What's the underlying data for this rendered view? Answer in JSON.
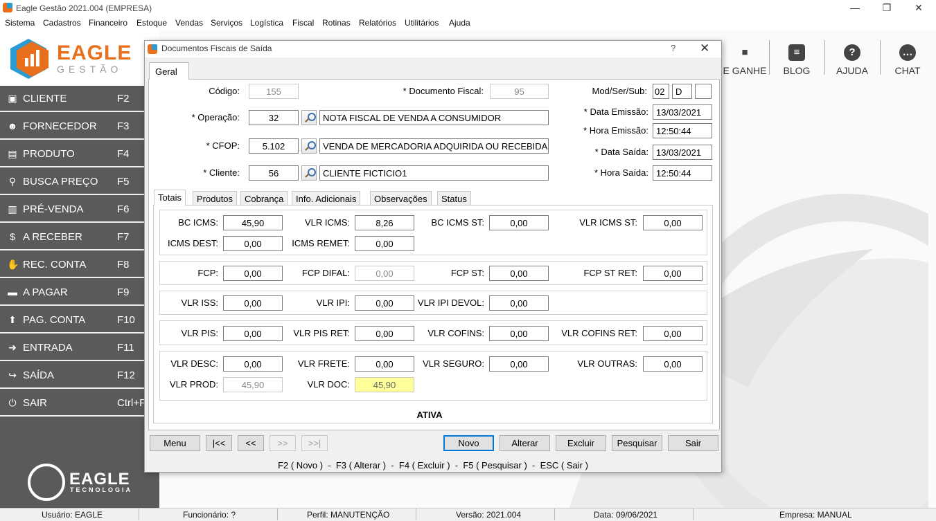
{
  "app": {
    "title": "Eagle Gestão 2021.004 (EMPRESA)",
    "window_buttons": {
      "minimize": "—",
      "restore": "❐",
      "close": "✕"
    }
  },
  "menu": [
    "Sistema",
    "Cadastros",
    "Financeiro",
    "Estoque",
    "Vendas",
    "Serviços",
    "Logística",
    "Fiscal",
    "Rotinas",
    "Relatórios",
    "Utilitários",
    "Ajuda"
  ],
  "logo": {
    "word": "EAGLE",
    "sub": "GESTÃO",
    "footer_word": "EAGLE",
    "footer_sub": "TECNOLOGIA"
  },
  "sidebar": [
    {
      "icon": "id-card-icon",
      "glyph": "▣",
      "label": "CLIENTE",
      "key": "F2"
    },
    {
      "icon": "users-icon",
      "glyph": "👥",
      "label": "FORNECEDOR",
      "key": "F3"
    },
    {
      "icon": "box-icon",
      "glyph": "▤",
      "label": "PRODUTO",
      "key": "F4"
    },
    {
      "icon": "search-icon",
      "glyph": "🔍",
      "label": "BUSCA PREÇO",
      "key": "F5"
    },
    {
      "icon": "basket-icon",
      "glyph": "🧺",
      "label": "PRÉ-VENDA",
      "key": "F6"
    },
    {
      "icon": "dollar-icon",
      "glyph": "$",
      "label": "A RECEBER",
      "key": "F7"
    },
    {
      "icon": "hand-money-icon",
      "glyph": "✋",
      "label": "REC. CONTA",
      "key": "F8"
    },
    {
      "icon": "wallet-icon",
      "glyph": "▬",
      "label": "A PAGAR",
      "key": "F9"
    },
    {
      "icon": "upload-icon",
      "glyph": "⬆",
      "label": "PAG. CONTA",
      "key": "F10"
    },
    {
      "icon": "sign-in-icon",
      "glyph": "➜",
      "label": "ENTRADA",
      "key": "F11"
    },
    {
      "icon": "sign-out-icon",
      "glyph": "↪",
      "label": "SAÍDA",
      "key": "F12"
    },
    {
      "icon": "power-icon",
      "glyph": "⏻",
      "label": "SAIR",
      "key": "Ctrl+F"
    }
  ],
  "topbar": [
    {
      "icon": "gift-icon",
      "glyph": "🎁",
      "label": "E GANHE"
    },
    {
      "icon": "blog-icon",
      "glyph": "≡",
      "label": "BLOG"
    },
    {
      "icon": "help-icon",
      "glyph": "?",
      "label": "AJUDA"
    },
    {
      "icon": "chat-icon",
      "glyph": "💬",
      "label": "CHAT"
    }
  ],
  "statusbar": {
    "usuario": "Usuário: EAGLE",
    "funcionario": "Funcionário: ?",
    "perfil": "Perfil: MANUTENÇÃO",
    "versao": "Versão: 2021.004",
    "data": "Data: 09/06/2021",
    "empresa": "Empresa: MANUAL"
  },
  "dialog": {
    "title": "Documentos Fiscais de Saída",
    "help": "?",
    "close": "✕",
    "tab": "Geral",
    "codigo_label": "Código:",
    "codigo": "155",
    "doc_fiscal_label": "* Documento Fiscal:",
    "doc_fiscal": "95",
    "modsersub_label": "Mod/Ser/Sub:",
    "mod": "02",
    "ser": "D",
    "sub": "",
    "operacao_label": "* Operação:",
    "operacao_code": "32",
    "operacao_desc": "NOTA FISCAL DE VENDA A CONSUMIDOR",
    "cfop_label": "* CFOP:",
    "cfop_code": "5.102",
    "cfop_desc": "VENDA DE MERCADORIA ADQUIRIDA OU RECEBIDA",
    "cliente_label": "* Cliente:",
    "cliente_code": "56",
    "cliente_desc": "CLIENTE FICTICIO1",
    "data_emissao_label": "* Data Emissão:",
    "data_emissao": "13/03/2021",
    "hora_emissao_label": "* Hora Emissão:",
    "hora_emissao": "12:50:44",
    "data_saida_label": "* Data Saída:",
    "data_saida": "13/03/2021",
    "hora_saida_label": "* Hora Saída:",
    "hora_saida": "12:50:44",
    "subtabs": [
      "Totais",
      "Produtos",
      "Cobrança",
      "Info. Adicionais",
      "Observações",
      "Status"
    ],
    "totais": {
      "bc_icms_label": "BC ICMS:",
      "bc_icms": "45,90",
      "vlr_icms_label": "VLR ICMS:",
      "vlr_icms": "8,26",
      "bc_icms_st_label": "BC ICMS ST:",
      "bc_icms_st": "0,00",
      "vlr_icms_st_label": "VLR ICMS ST:",
      "vlr_icms_st": "0,00",
      "icms_dest_label": "ICMS DEST:",
      "icms_dest": "0,00",
      "icms_remet_label": "ICMS REMET:",
      "icms_remet": "0,00",
      "fcp_label": "FCP:",
      "fcp": "0,00",
      "fcp_difal_label": "FCP DIFAL:",
      "fcp_difal": "0,00",
      "fcp_st_label": "FCP ST:",
      "fcp_st": "0,00",
      "fcp_st_ret_label": "FCP ST RET:",
      "fcp_st_ret": "0,00",
      "vlr_iss_label": "VLR ISS:",
      "vlr_iss": "0,00",
      "vlr_ipi_label": "VLR IPI:",
      "vlr_ipi": "0,00",
      "vlr_ipi_devol_label": "VLR IPI DEVOL:",
      "vlr_ipi_devol": "0,00",
      "vlr_pis_label": "VLR PIS:",
      "vlr_pis": "0,00",
      "vlr_pis_ret_label": "VLR PIS RET:",
      "vlr_pis_ret": "0,00",
      "vlr_cofins_label": "VLR COFINS:",
      "vlr_cofins": "0,00",
      "vlr_cofins_ret_label": "VLR COFINS RET:",
      "vlr_cofins_ret": "0,00",
      "vlr_desc_label": "VLR DESC:",
      "vlr_desc": "0,00",
      "vlr_frete_label": "VLR FRETE:",
      "vlr_frete": "0,00",
      "vlr_seguro_label": "VLR SEGURO:",
      "vlr_seguro": "0,00",
      "vlr_outras_label": "VLR OUTRAS:",
      "vlr_outras": "0,00",
      "vlr_prod_label": "VLR PROD:",
      "vlr_prod": "45,90",
      "vlr_doc_label": "VLR DOC:",
      "vlr_doc": "45,90"
    },
    "status": "ATIVA",
    "buttons": {
      "menu": "Menu",
      "first": "|<<",
      "prev": "<<",
      "next": ">>",
      "last": ">>|",
      "novo": "Novo",
      "alterar": "Alterar",
      "excluir": "Excluir",
      "pesquisar": "Pesquisar",
      "sair": "Sair"
    },
    "hint": "F2 ( Novo )  -  F3 ( Alterar )  -  F4 ( Excluir )  -  F5 ( Pesquisar )  -  ESC ( Sair )"
  },
  "colors": {
    "sidebar": "#5a5a5a",
    "brand_orange": "#e8701c",
    "brand_blue": "#2b9bd3",
    "highlight_yellow": "#ffff99",
    "focus_blue": "#0078d7"
  }
}
